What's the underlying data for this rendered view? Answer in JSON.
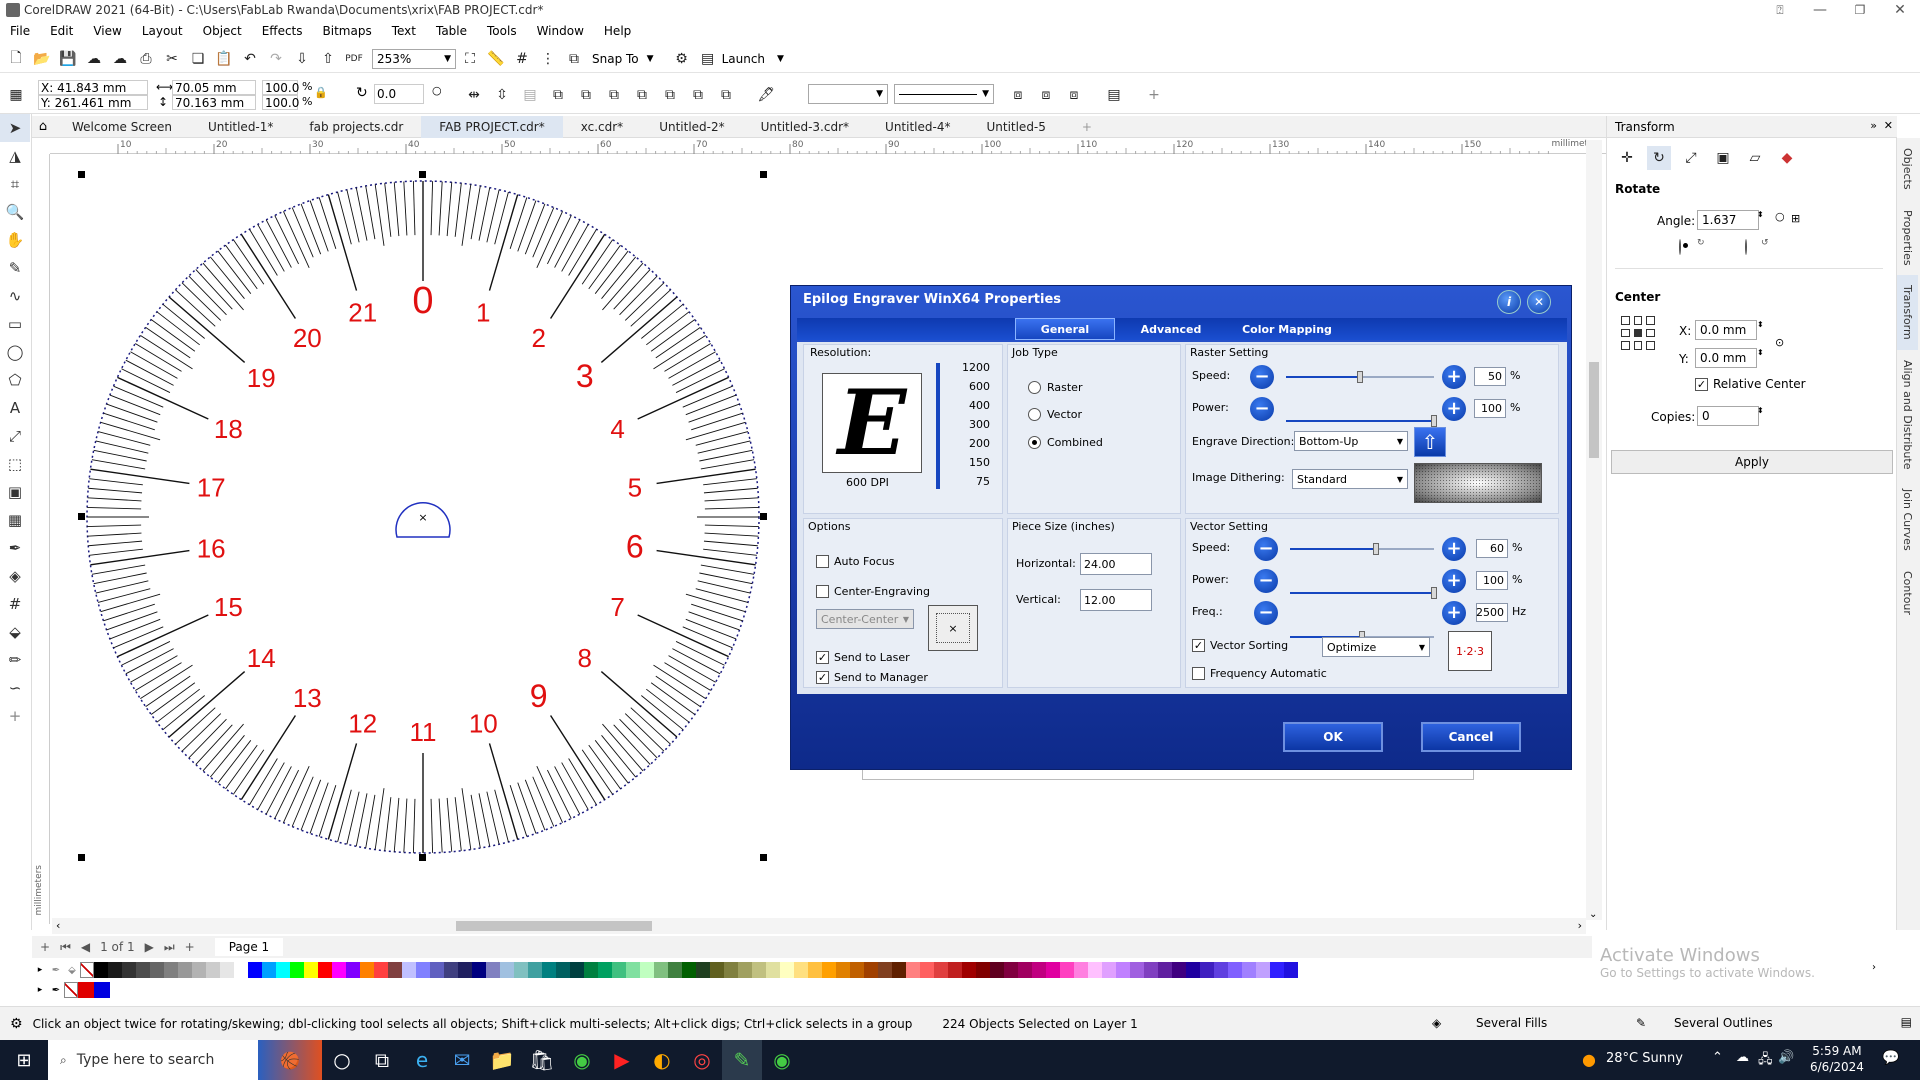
{
  "app": {
    "title": "CorelDRAW 2021 (64-Bit) - C:\\Users\\FabLab Rwanda\\Documents\\xrix\\FAB PROJECT.cdr*"
  },
  "menu": [
    "File",
    "Edit",
    "View",
    "Layout",
    "Object",
    "Effects",
    "Bitmaps",
    "Text",
    "Table",
    "Tools",
    "Window",
    "Help"
  ],
  "toolbar": {
    "zoom": "253%",
    "snap_to": "Snap To",
    "launch": "Launch"
  },
  "propbar": {
    "x": "X: 41.843 mm",
    "y": "Y: 261.461 mm",
    "w": "70.05 mm",
    "h": "70.163 mm",
    "sx": "100.0",
    "sy": "100.0",
    "pct": "%",
    "angle": "0.0"
  },
  "tabs": [
    "Welcome Screen",
    "Untitled-1*",
    "fab projects.cdr",
    "FAB PROJECT.cdr*",
    "xc.cdr*",
    "Untitled-2*",
    "Untitled-3.cdr*",
    "Untitled-4*",
    "Untitled-5"
  ],
  "ruler": {
    "ticks": [
      "10",
      "20",
      "30",
      "40",
      "50",
      "60",
      "70",
      "80",
      "90",
      "100",
      "110",
      "120",
      "130",
      "140",
      "150"
    ],
    "unit": "millimeters",
    "vunit": "millimeters"
  },
  "dial": {
    "labels": [
      "0",
      "1",
      "2",
      "3",
      "4",
      "5",
      "6",
      "7",
      "8",
      "9",
      "10",
      "11",
      "12",
      "13",
      "14",
      "15",
      "16",
      "17",
      "18",
      "19",
      "20",
      "21"
    ]
  },
  "dialog": {
    "title": "Epilog Engraver WinX64 Properties",
    "tabs": [
      "General",
      "Advanced",
      "Color Mapping"
    ],
    "resolution": {
      "label": "Resolution:",
      "dpi": "600 DPI",
      "options": [
        "1200",
        "600",
        "400",
        "300",
        "200",
        "150",
        "75"
      ],
      "letter": "E"
    },
    "job_type": {
      "label": "Job Type",
      "options": [
        "Raster",
        "Vector",
        "Combined"
      ],
      "selected": "Combined"
    },
    "raster": {
      "label": "Raster Setting",
      "speed_label": "Speed:",
      "speed": "50",
      "power_label": "Power:",
      "power": "100",
      "pct": "%",
      "engrave_dir_label": "Engrave Direction:",
      "engrave_dir": "Bottom-Up",
      "dither_label": "Image Dithering:",
      "dither": "Standard",
      "speed_fraction": 0.5,
      "power_fraction": 1.0
    },
    "options": {
      "label": "Options",
      "auto_focus": "Auto Focus",
      "center_engraving": "Center-Engraving",
      "center_select": "Center-Center",
      "send_laser": "Send to Laser",
      "send_manager": "Send to Manager"
    },
    "piece": {
      "label": "Piece Size (inches)",
      "h_label": "Horizontal:",
      "h": "24.00",
      "v_label": "Vertical:",
      "v": "12.00"
    },
    "vector": {
      "label": "Vector Setting",
      "speed_label": "Speed:",
      "speed": "60",
      "power_label": "Power:",
      "power": "100",
      "freq_label": "Freq.:",
      "freq": "2500",
      "hz": "Hz",
      "pct": "%",
      "sorting": "Vector Sorting",
      "sorting_mode": "Optimize",
      "freq_auto": "Frequency Automatic",
      "speed_fraction": 0.6,
      "power_fraction": 1.0,
      "freq_fraction": 0.5
    },
    "ok": "OK",
    "cancel": "Cancel"
  },
  "transform": {
    "title": "Transform",
    "rotate": "Rotate",
    "angle_label": "Angle:",
    "angle": "1.637",
    "center": "Center",
    "x_label": "X:",
    "x": "0.0 mm",
    "y_label": "Y:",
    "y": "0.0 mm",
    "relative": "Relative Center",
    "copies_label": "Copies:",
    "copies": "0",
    "apply": "Apply"
  },
  "side_tabs": [
    "Objects",
    "Properties",
    "Transform",
    "Align and Distribute",
    "Join Curves",
    "Contour"
  ],
  "pagebar": {
    "page_of": "1 of 1",
    "page": "Page 1"
  },
  "status": {
    "hint": "Click an object twice for rotating/skewing; dbl-clicking tool selects all objects; Shift+click multi-selects; Alt+click digs; Ctrl+click selects in a group",
    "selected": "224 Objects Selected on Layer 1",
    "fills": "Several Fills",
    "outlines": "Several Outlines"
  },
  "watermark": {
    "line1": "Activate Windows",
    "line2": "Go to Settings to activate Windows."
  },
  "taskbar": {
    "search": "Type here to search",
    "weather": "28°C  Sunny",
    "time": "5:59 AM",
    "date": "6/6/2024"
  },
  "palette": [
    "#000000",
    "#1a1a1a",
    "#333333",
    "#4d4d4d",
    "#666666",
    "#808080",
    "#999999",
    "#b3b3b3",
    "#cccccc",
    "#e6e6e6",
    "#ffffff",
    "#0000ff",
    "#00a0ff",
    "#00ffff",
    "#00ff00",
    "#ffff00",
    "#ff0000",
    "#ff00ff",
    "#8000ff",
    "#ff8000",
    "#ff4040",
    "#804040",
    "#c0c0ff",
    "#8080ff",
    "#6060c0",
    "#404080",
    "#202060",
    "#000080",
    "#8080c0",
    "#a0c0e0",
    "#80c0c0",
    "#40a0a0",
    "#008080",
    "#006060",
    "#004040",
    "#008040",
    "#00a060",
    "#40c080",
    "#80e0a0",
    "#c0ffc0",
    "#80c080",
    "#408040",
    "#006000",
    "#204020",
    "#606020",
    "#808040",
    "#a0a060",
    "#c0c080",
    "#e0e0a0",
    "#ffffc0",
    "#ffe080",
    "#ffc040",
    "#ffa000",
    "#e08000",
    "#c06000",
    "#a04000",
    "#804020",
    "#602000",
    "#ff8080",
    "#ff6060",
    "#e04040",
    "#c02020",
    "#a00000",
    "#800000",
    "#600020",
    "#800040",
    "#a00060",
    "#c00080",
    "#e000a0",
    "#ff40c0",
    "#ff80e0",
    "#ffc0ff",
    "#e0a0ff",
    "#c080ff",
    "#a060e0",
    "#8040c0",
    "#6020a0",
    "#400080",
    "#2000a0",
    "#4020c0",
    "#6040e0",
    "#8060ff",
    "#a080ff",
    "#c0a0ff",
    "#3020ff",
    "#2010e0"
  ]
}
